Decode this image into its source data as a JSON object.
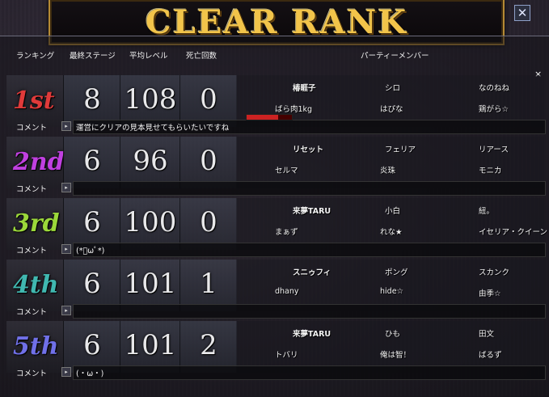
{
  "window": {
    "title": "CLEAR RANK",
    "close_symbol": "✕",
    "corner_symbol": "×"
  },
  "headers": {
    "ranking": "ランキング",
    "final_stage": "最終ステージ",
    "avg_level": "平均レベル",
    "deaths": "死亡回数",
    "party": "パーティーメンバー"
  },
  "comment_label": "コメント",
  "comment_arrow": "▸",
  "colors": {
    "title_gold": "#f2c44a",
    "rank1": "#e03a3a",
    "rank2": "#c040e0",
    "rank3": "#9bd83a",
    "rank4": "#40b8b0",
    "rank5": "#7070e8"
  },
  "ranks": [
    {
      "label": "1st",
      "final_stage": "8",
      "avg_level": "108",
      "deaths": "0",
      "members": [
        "椿睚子",
        "シロ",
        "なのねね",
        "ばら肉1kg",
        "はぴな",
        "鶏がら☆"
      ],
      "comment": "運営にクリアの見本見せてもらいたいですね"
    },
    {
      "label": "2nd",
      "final_stage": "6",
      "avg_level": "96",
      "deaths": "0",
      "members": [
        "リセット",
        "フェリア",
        "リアース",
        "セルマ",
        "炎珠",
        "モニカ"
      ],
      "comment": ""
    },
    {
      "label": "3rd",
      "final_stage": "6",
      "avg_level": "100",
      "deaths": "0",
      "members": [
        "来夢TARU",
        "小白",
        "紐。",
        "まぁず",
        "れな★",
        "イセリア・クイーン"
      ],
      "comment": "(*ﾟωﾟ*)"
    },
    {
      "label": "4th",
      "final_stage": "6",
      "avg_level": "101",
      "deaths": "1",
      "members": [
        "スニゥフィ",
        "ポング",
        "スカンク",
        "dhany",
        "hide☆",
        "由季☆"
      ],
      "comment": ""
    },
    {
      "label": "5th",
      "final_stage": "6",
      "avg_level": "101",
      "deaths": "2",
      "members": [
        "来夢TARU",
        "ひも",
        "田文",
        "トバリ",
        "俺は智！",
        "ばるず"
      ],
      "comment": "(・ω・)"
    }
  ]
}
